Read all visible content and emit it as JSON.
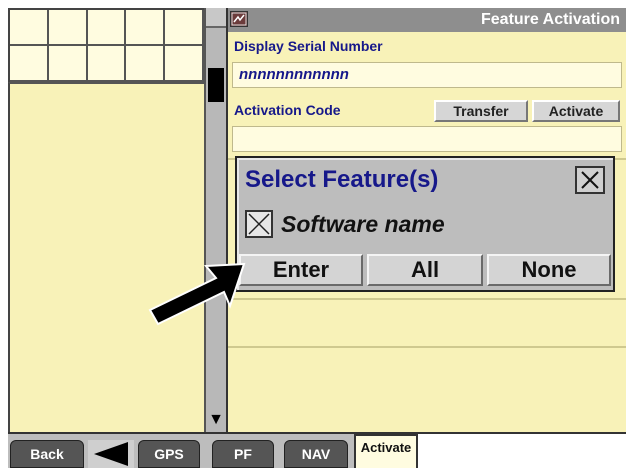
{
  "window": {
    "title": "Feature Activation"
  },
  "serial": {
    "label": "Display Serial Number",
    "value": "nnnnnnnnnnnn"
  },
  "activation": {
    "label": "Activation Code",
    "value": "",
    "transfer_label": "Transfer",
    "activate_label": "Activate"
  },
  "dialog": {
    "title": "Select Feature(s)",
    "feature": {
      "label": "Software name",
      "checked": true
    },
    "enter_label": "Enter",
    "all_label": "All",
    "none_label": "None"
  },
  "tabs": {
    "back": "Back",
    "gps": "GPS",
    "pf": "PF",
    "nav": "NAV",
    "activate": "Activate"
  },
  "colors": {
    "panel": "#f8f2b8",
    "label_text": "#16188a",
    "title_bar": "#8e8e8e",
    "dialog_bg": "#bdbdbd"
  },
  "icons": [
    "window-icon",
    "scroll-down-arrow-icon",
    "close-icon",
    "checkbox-x-icon",
    "back-arrow-icon",
    "pointer-arrow-icon"
  ]
}
